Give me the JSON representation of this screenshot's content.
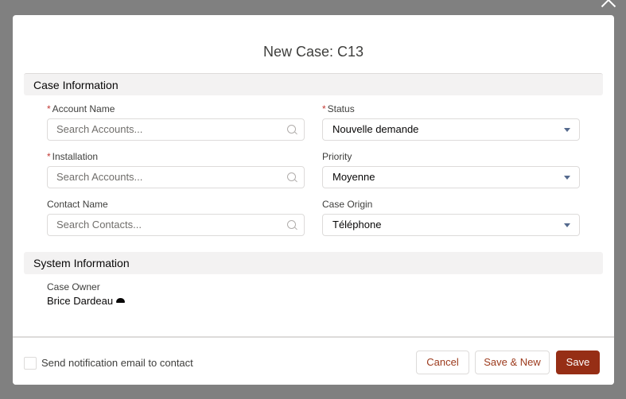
{
  "modal": {
    "title": "New Case: C13",
    "close_icon": "close-icon"
  },
  "case_information": {
    "header": "Case Information",
    "fields": {
      "account_name": {
        "label": "Account Name",
        "required": true,
        "placeholder": "Search Accounts...",
        "value": "",
        "icon": "search-icon"
      },
      "installation": {
        "label": "Installation",
        "required": true,
        "placeholder": "Search Accounts...",
        "value": "",
        "icon": "search-icon"
      },
      "contact_name": {
        "label": "Contact Name",
        "required": false,
        "placeholder": "Search Contacts...",
        "value": "",
        "icon": "search-icon"
      },
      "status": {
        "label": "Status",
        "required": true,
        "value": "Nouvelle demande",
        "icon": "chevron-down-icon"
      },
      "priority": {
        "label": "Priority",
        "required": false,
        "value": "Moyenne",
        "icon": "chevron-down-icon"
      },
      "case_origin": {
        "label": "Case Origin",
        "required": false,
        "value": "Téléphone",
        "icon": "chevron-down-icon"
      }
    },
    "required_marker": "*"
  },
  "system_information": {
    "header": "System Information",
    "case_owner_label": "Case Owner",
    "case_owner_value": "Brice Dardeau",
    "owner_icon": "cloud-icon"
  },
  "footer": {
    "notify_label": "Send notification email to contact",
    "notify_checked": false,
    "cancel_label": "Cancel",
    "save_new_label": "Save & New",
    "save_label": "Save"
  },
  "colors": {
    "brand_button": "#962e15",
    "required": "#c23934",
    "overlay": "#808080"
  }
}
